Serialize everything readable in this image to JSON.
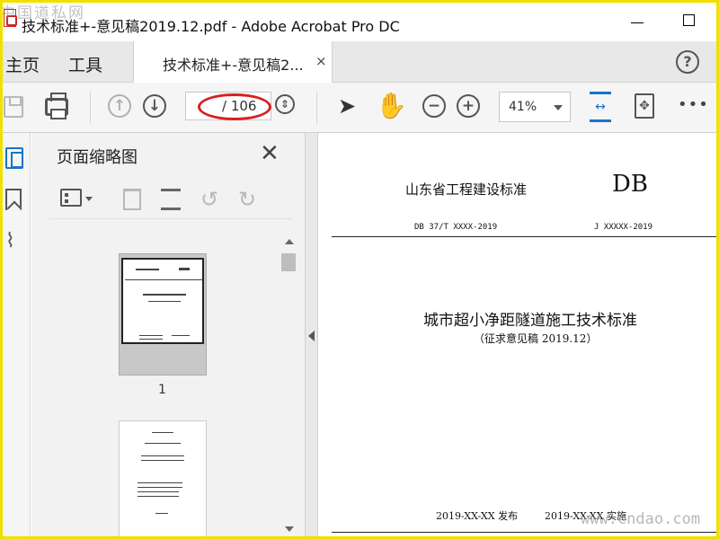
{
  "window": {
    "title": "技术标准+-意见稿2019.12.pdf - Adobe Acrobat Pro DC",
    "minimize_glyph": "—",
    "maximize_glyph": "☐"
  },
  "watermark_top": "中国道私网",
  "watermark_bottom": "www.cndao.com",
  "nav": {
    "home": "主页",
    "tools": "工具",
    "doc_tab": "技术标准+-意见稿2...",
    "doc_tab_close": "×",
    "help": "?"
  },
  "toolbar": {
    "page_current": "",
    "page_total": "/ 106",
    "zoom": "41%",
    "more": "•••"
  },
  "panel": {
    "title": "页面缩略图",
    "close": "✕",
    "thumb1_number": "1"
  },
  "document": {
    "org": "山东省工程建设标准",
    "code_mark": "DB",
    "standard_no": "DB 37/T XXXX-2019",
    "record_no": "J XXXXX-2019",
    "title": "城市超小净距隧道施工技术标准",
    "subtitle": "（征求意见稿 2019.12）",
    "publish": "2019-XX-XX 发布",
    "implement": "2019-XX-XX 实施"
  },
  "colors": {
    "accent_blue": "#1a73c8",
    "annotation_red": "#d82020",
    "frame_yellow": "#f0e000"
  },
  "icons": [
    "app-pdf-icon",
    "save-icon",
    "print-icon",
    "prev-page-icon",
    "next-page-icon",
    "page-nav-icon",
    "select-cursor-icon",
    "hand-tool-icon",
    "zoom-out-icon",
    "zoom-in-icon",
    "fit-width-icon",
    "fit-page-icon",
    "more-icon",
    "pages-icon",
    "bookmark-icon",
    "attachment-icon",
    "options-icon",
    "trash-icon",
    "extract-icon",
    "rotate-left-icon",
    "rotate-right-icon"
  ]
}
